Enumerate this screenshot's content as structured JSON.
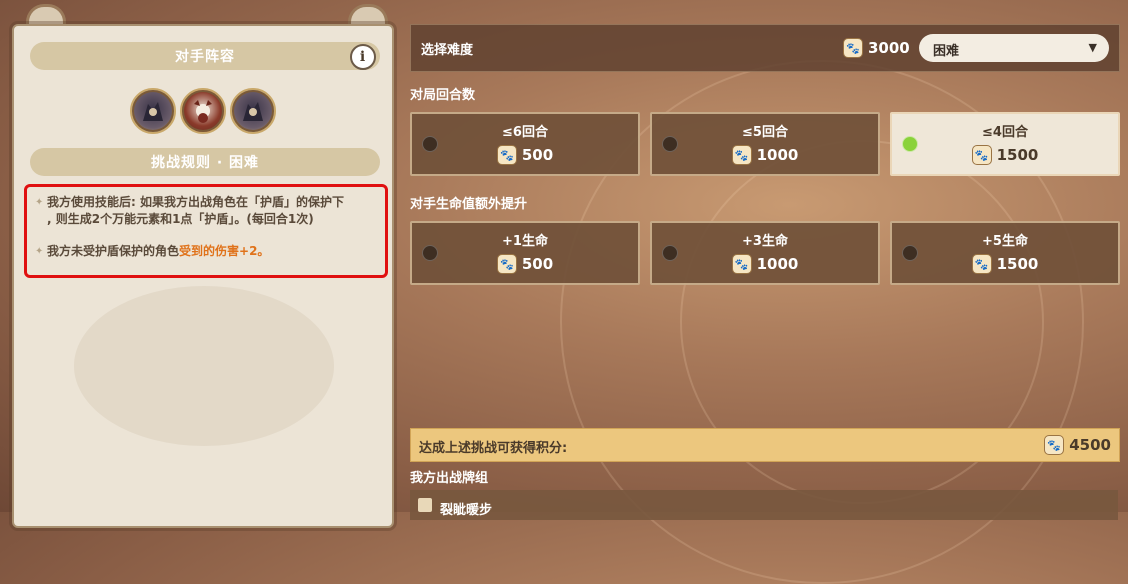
{
  "left_panel": {
    "opponent_header": "对手阵容",
    "info_icon_glyph": "i",
    "rules_header": "挑战规则 · 困难",
    "rules": [
      {
        "text_lines": [
          "我方使用技能后: 如果我方出战角色在「护盾」的保护下",
          ", 则生成2个万能元素和1点「护盾」。(每回合1次)"
        ]
      },
      {
        "text_before": "我方未受护盾保护的角色",
        "text_highlight": "受到的伤害+2",
        "text_after": "。"
      }
    ],
    "avatars": [
      "avatar-opponent-1",
      "avatar-opponent-2",
      "avatar-opponent-3"
    ]
  },
  "difficulty": {
    "title": "选择难度",
    "points": "3000",
    "selected": "困难",
    "caret": "▼"
  },
  "rounds": {
    "label": "对局回合数",
    "options": [
      {
        "title": "≤6回合",
        "cost": "500",
        "selected": false
      },
      {
        "title": "≤5回合",
        "cost": "1000",
        "selected": false
      },
      {
        "title": "≤4回合",
        "cost": "1500",
        "selected": true
      }
    ]
  },
  "hp_bonus": {
    "label": "对手生命值额外提升",
    "options": [
      {
        "title": "+1生命",
        "cost": "500",
        "selected": false
      },
      {
        "title": "+3生命",
        "cost": "1000",
        "selected": false
      },
      {
        "title": "+5生命",
        "cost": "1500",
        "selected": false
      }
    ]
  },
  "summary": {
    "label": "达成上述挑战可获得积分:",
    "points": "4500"
  },
  "deck": {
    "label": "我方出战牌组",
    "first_deck_name": "裂眦暖步"
  },
  "icons": {
    "paw": "🐾"
  },
  "colors": {
    "accent_green": "#8ad23a",
    "highlight_orange": "#e0721a",
    "summary_bg": "#ecc77e"
  }
}
